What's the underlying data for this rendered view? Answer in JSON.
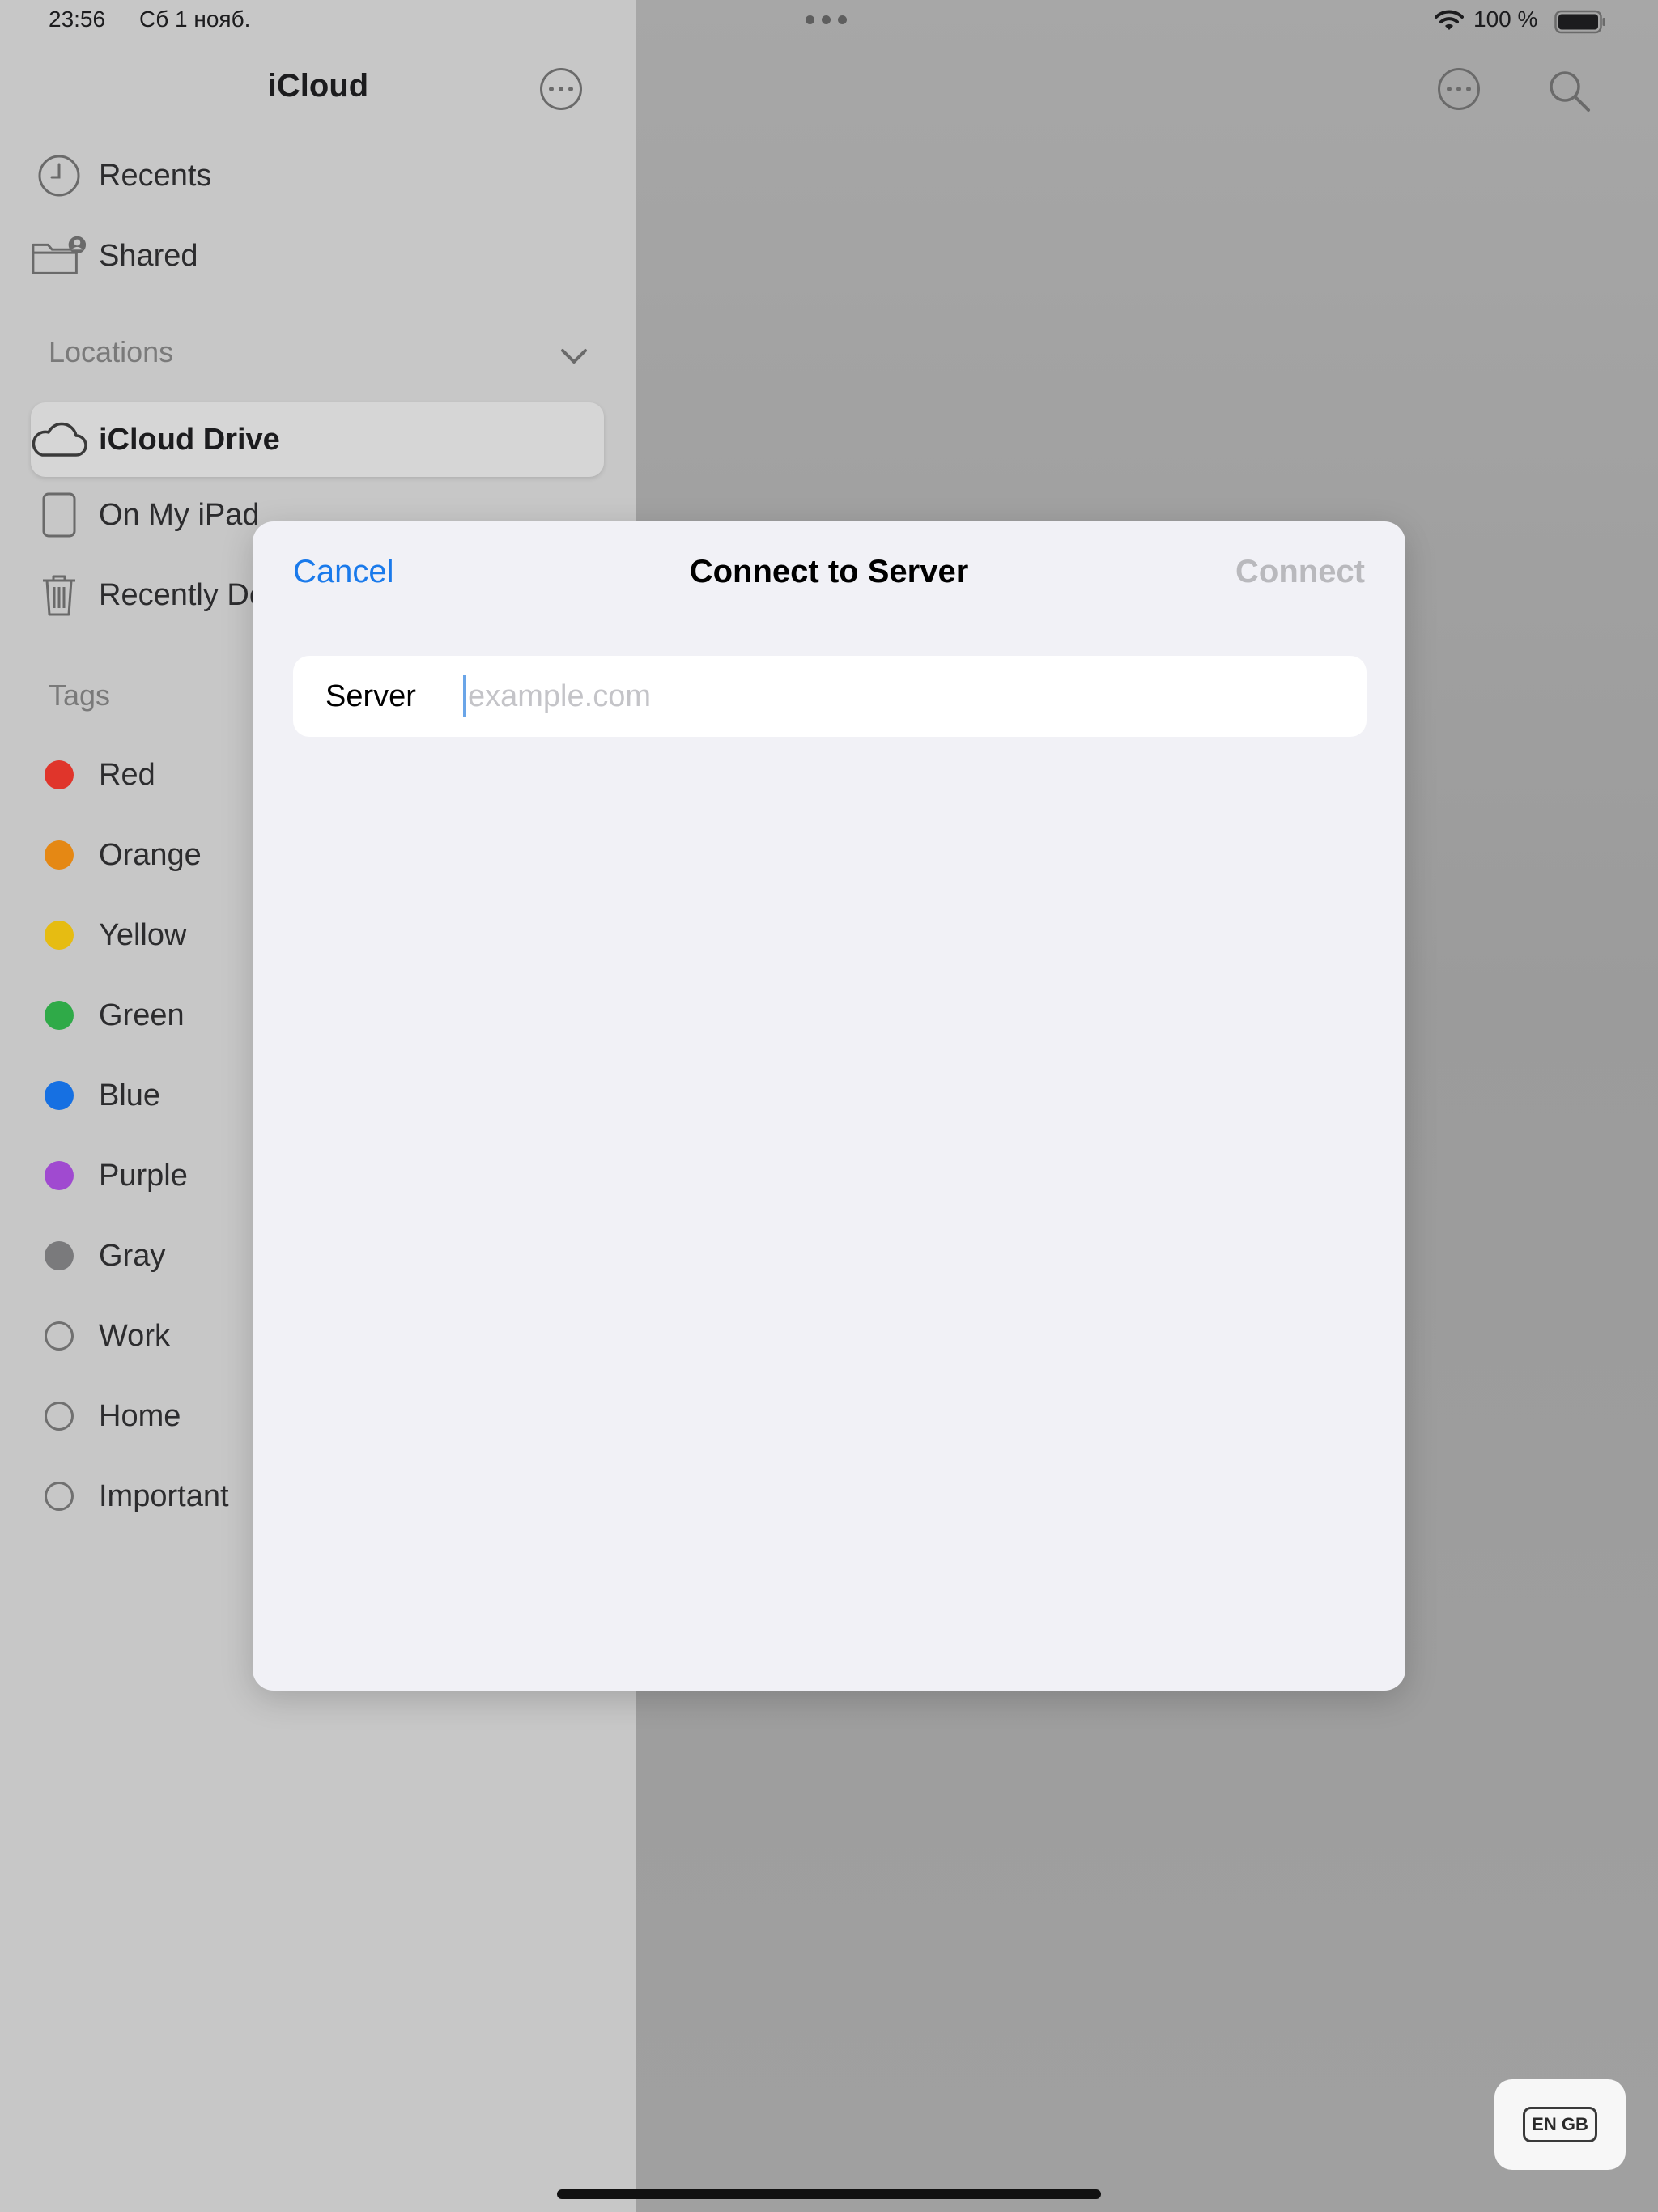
{
  "status_bar": {
    "time": "23:56",
    "date": "Сб 1 нояб.",
    "battery": "100 %"
  },
  "sidebar": {
    "title": "iCloud",
    "top_items": [
      {
        "label": "Recents",
        "icon": "clock-icon"
      },
      {
        "label": "Shared",
        "icon": "shared-folder-icon"
      }
    ],
    "locations_header": "Locations",
    "locations": [
      {
        "label": "iCloud Drive",
        "icon": "cloud-icon",
        "selected": true
      },
      {
        "label": "On My iPad",
        "icon": "ipad-icon"
      },
      {
        "label": "Recently Deleted",
        "icon": "trash-icon"
      }
    ],
    "tags_header": "Tags",
    "tags": [
      {
        "label": "Red",
        "color": "#e0352b"
      },
      {
        "label": "Orange",
        "color": "#e58814"
      },
      {
        "label": "Yellow",
        "color": "#e6bc12"
      },
      {
        "label": "Green",
        "color": "#2faa48"
      },
      {
        "label": "Blue",
        "color": "#1670e2"
      },
      {
        "label": "Purple",
        "color": "#a04ad0"
      },
      {
        "label": "Gray",
        "color": "#7a7a7c"
      },
      {
        "label": "Work",
        "color": ""
      },
      {
        "label": "Home",
        "color": ""
      },
      {
        "label": "Important",
        "color": ""
      }
    ]
  },
  "dialog": {
    "cancel": "Cancel",
    "title": "Connect to Server",
    "connect": "Connect",
    "server_label": "Server",
    "server_placeholder": "example.com",
    "server_value": ""
  },
  "keyboard": {
    "language_badge": "EN GB"
  },
  "colors": {
    "accent": "#1a7aeb",
    "disabled": "#b9b9bd"
  }
}
